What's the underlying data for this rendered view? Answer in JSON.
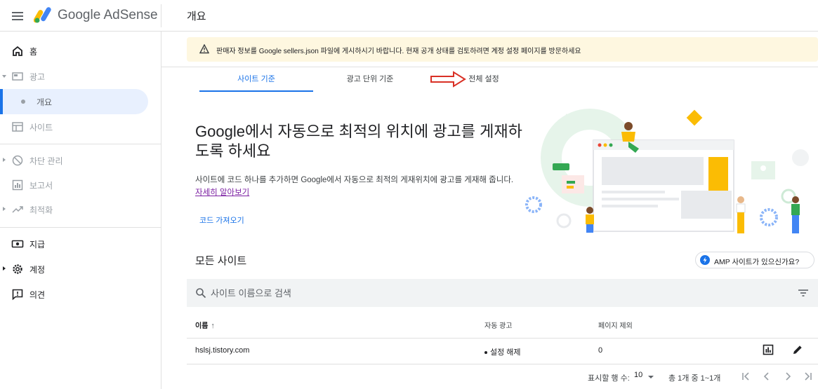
{
  "header": {
    "brand": "Google AdSense",
    "page_title": "개요"
  },
  "sidebar": {
    "items": [
      {
        "label": "홈",
        "icon": "home-icon"
      },
      {
        "label": "광고",
        "icon": "ads-icon"
      },
      {
        "label": "개요",
        "icon": "dot"
      },
      {
        "label": "사이트",
        "icon": "sites-icon"
      },
      {
        "label": "차단 관리",
        "icon": "block-icon"
      },
      {
        "label": "보고서",
        "icon": "reports-icon"
      },
      {
        "label": "최적화",
        "icon": "optimize-icon"
      },
      {
        "label": "지급",
        "icon": "payments-icon"
      },
      {
        "label": "계정",
        "icon": "gear-icon"
      },
      {
        "label": "의견",
        "icon": "feedback-icon"
      }
    ]
  },
  "banner": {
    "message": "판매자 정보를 Google sellers.json 파일에 게시하시기 바랍니다. 현재 공개 상태를 검토하려면 계정 설정 페이지를 방문하세요"
  },
  "tabs": [
    {
      "label": "사이트 기준",
      "active": true
    },
    {
      "label": "광고 단위 기준",
      "active": false
    },
    {
      "label": "전체 설정",
      "active": false
    }
  ],
  "hero": {
    "title": "Google에서 자동으로 최적의 위치에 광고를 게재하도록 하세요",
    "description": "사이트에 코드 하나를 추가하면 Google에서 자동으로 최적의 게재위치에 광고를 게재해 줍니다.",
    "learn_more": "자세히 알아보기",
    "get_code": "코드 가져오기"
  },
  "sites": {
    "title": "모든 사이트",
    "amp_button": "AMP 사이트가 있으신가요?",
    "search_placeholder": "사이트 이름으로 검색",
    "columns": [
      "이름",
      "자동 광고",
      "페이지 제외"
    ],
    "rows": [
      {
        "name": "hslsj.tistory.com",
        "auto_ads": "설정 해제",
        "excluded_pages": "0"
      }
    ]
  },
  "pagination": {
    "rows_per_page_label": "표시할 행 수:",
    "rows_per_page": "10",
    "range": "총 1개 중 1~1개"
  },
  "colors": {
    "accent": "#1a73e8",
    "banner_bg": "#fef7e0",
    "annotation_arrow": "#d93025"
  }
}
